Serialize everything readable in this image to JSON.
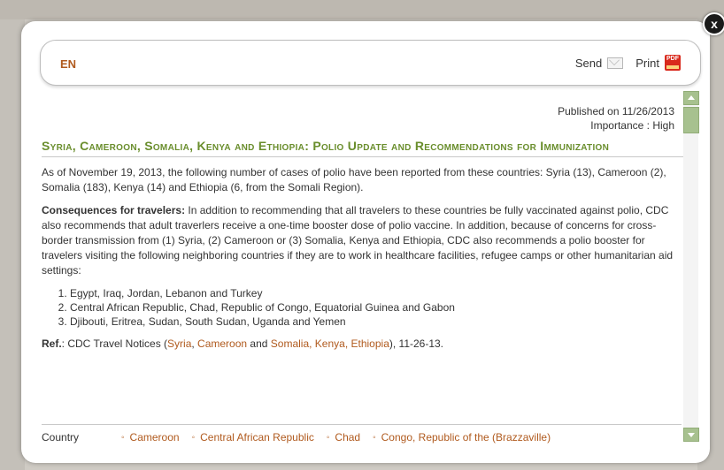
{
  "header": {
    "lang": "EN",
    "send_label": "Send",
    "print_label": "Print"
  },
  "close_label": "x",
  "article": {
    "published": "Published on 11/26/2013",
    "importance": "Importance : High",
    "title": "Syria, Cameroon, Somalia, Kenya and Ethiopia: Polio Update and Recommendations for Immunization",
    "intro": "As of November 19, 2013, the following number of cases of polio have been reported from these countries: Syria (13), Cameroon (2), Somalia (183), Kenya (14) and Ethiopia (6, from the Somali Region).",
    "consequences_label": "Consequences for travelers:",
    "consequences_text": " In addition to recommending that all travelers to these countries be fully vaccinated against polio, CDC also recommends that adult traverlers receive a one-time booster dose of polio vaccine. In addition, because of concerns for cross-border transmission from (1) Syria, (2) Cameroon or (3) Somalia, Kenya and Ethiopia, CDC also recommends a polio booster for travelers visiting the following neighboring countries if they are to work in healthcare facilities, refugee camps or other humanitarian aid settings:",
    "list": [
      "Egypt, Iraq, Jordan, Lebanon and Turkey",
      "Central African Republic, Chad, Republic of Congo, Equatorial Guinea and Gabon",
      "Djibouti, Eritrea, Sudan, South Sudan, Uganda and Yemen"
    ],
    "ref_label": "Ref.",
    "ref_prefix": ": CDC Travel Notices (",
    "ref_link1": "Syria",
    "ref_sep1": ", ",
    "ref_link2": "Cameroon",
    "ref_sep2": " and ",
    "ref_link3": "Somalia, Kenya, Ethiopia",
    "ref_suffix": "), 11-26-13."
  },
  "country": {
    "label": "Country",
    "items": [
      "Cameroon",
      "Central African Republic",
      "Chad",
      "Congo, Republic of the (Brazzaville)"
    ]
  },
  "icons": {
    "mail": "mail-icon",
    "pdf": "pdf-icon"
  },
  "colors": {
    "accent": "#b05a1e",
    "title": "#6a8e2d",
    "scroll": "#a7c18f"
  }
}
